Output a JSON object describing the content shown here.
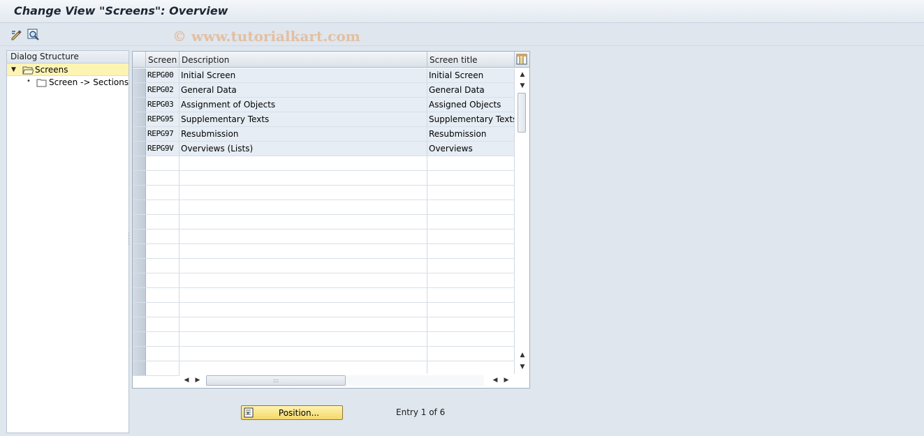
{
  "window": {
    "title": "Change View \"Screens\": Overview",
    "watermark": "© www.tutorialkart.com"
  },
  "toolbar": {
    "icons": [
      "display-change-icon",
      "search-icon"
    ]
  },
  "dialog_structure": {
    "header": "Dialog Structure",
    "items": [
      {
        "label": "Screens",
        "selected": true,
        "expanded": true,
        "level": 0,
        "icon": "folder-open-icon"
      },
      {
        "label": "Screen -> Sections",
        "selected": false,
        "level": 1,
        "icon": "folder-icon"
      }
    ]
  },
  "table": {
    "columns": [
      "Screen",
      "Description",
      "Screen title"
    ],
    "rows": [
      {
        "screen": "REPG00",
        "description": "Initial Screen",
        "title": "Initial Screen"
      },
      {
        "screen": "REPG02",
        "description": "General Data",
        "title": "General Data"
      },
      {
        "screen": "REPG03",
        "description": "Assignment of Objects",
        "title": "Assigned Objects"
      },
      {
        "screen": "REPG95",
        "description": "Supplementary Texts",
        "title": "Supplementary Texts"
      },
      {
        "screen": "REPG97",
        "description": "Resubmission",
        "title": "Resubmission"
      },
      {
        "screen": "REPG9V",
        "description": "Overviews (Lists)",
        "title": "Overviews"
      }
    ],
    "empty_row_count": 15
  },
  "footer": {
    "position_button": "Position...",
    "entry_info": "Entry 1 of 6"
  },
  "colors": {
    "background": "#dfe6ee",
    "selection": "#fdf4b4",
    "button": "#f4d86a"
  }
}
